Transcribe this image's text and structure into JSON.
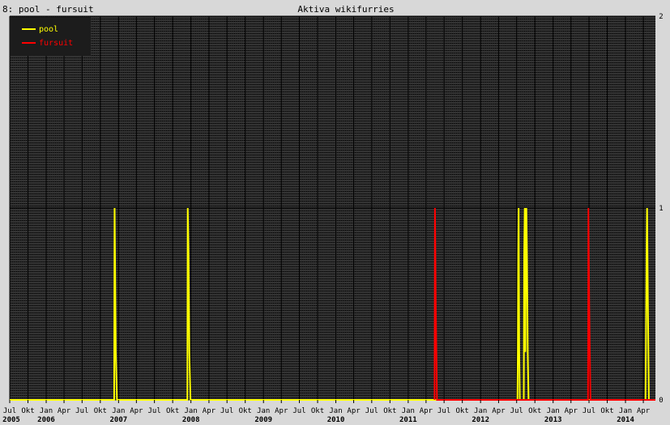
{
  "window": {
    "corner_label": "8: pool - fursuit"
  },
  "colors": {
    "background": "#d8d8d8",
    "plot_bg": "#333333",
    "grid_dotted": "#000000",
    "grid_solid": "#000000",
    "pool": "#ffff00",
    "fursuit": "#ff0000",
    "legend_bg": "#1c1c1c"
  },
  "chart_data": {
    "type": "line",
    "title": "Aktiva wikifurries",
    "x_range": [
      "2005-07-01",
      "2014-06-01"
    ],
    "ylim": [
      0,
      2
    ],
    "y_ticks": [
      {
        "value": 2,
        "label": "2"
      },
      {
        "value": 1,
        "label": "1"
      },
      {
        "value": 0,
        "label": "0"
      }
    ],
    "grid": true,
    "legend_position": "top-left",
    "month_ticks": [
      {
        "date": "2005-07",
        "label": "Jul"
      },
      {
        "date": "2005-10",
        "label": "Okt"
      },
      {
        "date": "2006-01",
        "label": "Jan"
      },
      {
        "date": "2006-04",
        "label": "Apr"
      },
      {
        "date": "2006-07",
        "label": "Jul"
      },
      {
        "date": "2006-10",
        "label": "Okt"
      },
      {
        "date": "2007-01",
        "label": "Jan"
      },
      {
        "date": "2007-04",
        "label": "Apr"
      },
      {
        "date": "2007-07",
        "label": "Jul"
      },
      {
        "date": "2007-10",
        "label": "Okt"
      },
      {
        "date": "2008-01",
        "label": "Jan"
      },
      {
        "date": "2008-04",
        "label": "Apr"
      },
      {
        "date": "2008-07",
        "label": "Jul"
      },
      {
        "date": "2008-10",
        "label": "Okt"
      },
      {
        "date": "2009-01",
        "label": "Jan"
      },
      {
        "date": "2009-04",
        "label": "Apr"
      },
      {
        "date": "2009-07",
        "label": "Jul"
      },
      {
        "date": "2009-10",
        "label": "Okt"
      },
      {
        "date": "2010-01",
        "label": "Jan"
      },
      {
        "date": "2010-04",
        "label": "Apr"
      },
      {
        "date": "2010-07",
        "label": "Jul"
      },
      {
        "date": "2010-10",
        "label": "Okt"
      },
      {
        "date": "2011-01",
        "label": "Jan"
      },
      {
        "date": "2011-04",
        "label": "Apr"
      },
      {
        "date": "2011-07",
        "label": "Jul"
      },
      {
        "date": "2011-10",
        "label": "Okt"
      },
      {
        "date": "2012-01",
        "label": "Jan"
      },
      {
        "date": "2012-04",
        "label": "Apr"
      },
      {
        "date": "2012-07",
        "label": "Jul"
      },
      {
        "date": "2012-10",
        "label": "Okt"
      },
      {
        "date": "2013-01",
        "label": "Jan"
      },
      {
        "date": "2013-04",
        "label": "Apr"
      },
      {
        "date": "2013-07",
        "label": "Jul"
      },
      {
        "date": "2013-10",
        "label": "Okt"
      },
      {
        "date": "2014-01",
        "label": "Jan"
      },
      {
        "date": "2014-04",
        "label": "Apr"
      }
    ],
    "year_ticks": [
      {
        "date": "2005-07",
        "label": "2005"
      },
      {
        "date": "2006-01",
        "label": "2006"
      },
      {
        "date": "2007-01",
        "label": "2007"
      },
      {
        "date": "2008-01",
        "label": "2008"
      },
      {
        "date": "2009-01",
        "label": "2009"
      },
      {
        "date": "2010-01",
        "label": "2010"
      },
      {
        "date": "2011-01",
        "label": "2011"
      },
      {
        "date": "2012-01",
        "label": "2012"
      },
      {
        "date": "2013-01",
        "label": "2013"
      },
      {
        "date": "2014-01",
        "label": "2014"
      }
    ],
    "series": [
      {
        "name": "pool",
        "color": "#ffff00",
        "points": [
          [
            "2005-07-01",
            0
          ],
          [
            "2006-12-10",
            0
          ],
          [
            "2006-12-12",
            1
          ],
          [
            "2006-12-14",
            0.75
          ],
          [
            "2006-12-18",
            0.25
          ],
          [
            "2006-12-24",
            0
          ],
          [
            "2007-12-14",
            0
          ],
          [
            "2007-12-16",
            1
          ],
          [
            "2007-12-20",
            0.75
          ],
          [
            "2007-12-24",
            0.25
          ],
          [
            "2007-12-30",
            0
          ],
          [
            "2011-05-14",
            0
          ],
          [
            "2012-07-05",
            0
          ],
          [
            "2012-07-07",
            0.25
          ],
          [
            "2012-07-09",
            0.75
          ],
          [
            "2012-07-11",
            1
          ],
          [
            "2012-07-14",
            0.25
          ],
          [
            "2012-07-17",
            0
          ],
          [
            "2012-08-06",
            0
          ],
          [
            "2012-08-08",
            0.75
          ],
          [
            "2012-08-11",
            1
          ],
          [
            "2012-08-14",
            0.25
          ],
          [
            "2012-08-16",
            0.75
          ],
          [
            "2012-08-19",
            1
          ],
          [
            "2012-08-22",
            0.75
          ],
          [
            "2012-08-26",
            0.25
          ],
          [
            "2012-08-30",
            0
          ],
          [
            "2014-04-12",
            0
          ],
          [
            "2014-04-14",
            0.25
          ],
          [
            "2014-04-17",
            0.75
          ],
          [
            "2014-04-20",
            1
          ],
          [
            "2014-04-24",
            0.5
          ],
          [
            "2014-04-29",
            0
          ],
          [
            "2014-06-01",
            0
          ]
        ]
      },
      {
        "name": "fursuit",
        "color": "#ff0000",
        "points": [
          [
            "2011-05-14",
            0
          ],
          [
            "2011-05-16",
            1
          ],
          [
            "2011-05-20",
            0.5
          ],
          [
            "2011-05-26",
            0
          ],
          [
            "2013-06-26",
            0
          ],
          [
            "2013-06-28",
            1
          ],
          [
            "2013-07-02",
            0.5
          ],
          [
            "2013-07-08",
            0
          ],
          [
            "2014-06-01",
            0
          ]
        ]
      }
    ]
  }
}
